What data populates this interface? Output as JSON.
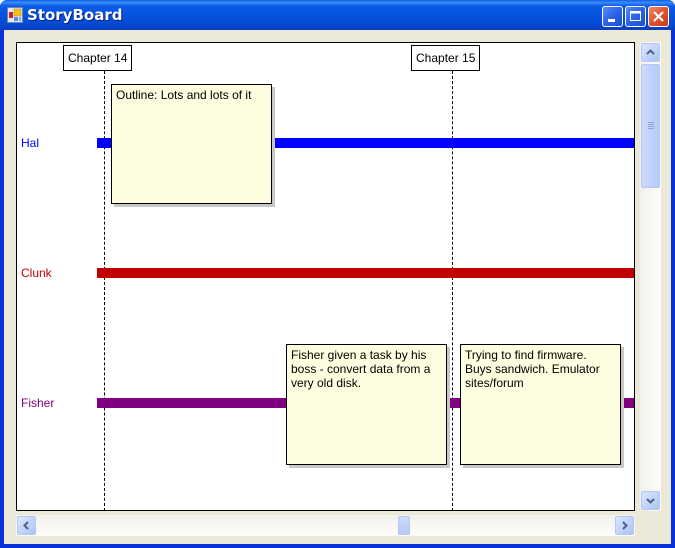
{
  "window": {
    "title": "StoryBoard",
    "icon": "storyboard-app-icon",
    "controls": [
      "minimize",
      "maximize",
      "close"
    ]
  },
  "chapters": [
    {
      "label": "Chapter 14"
    },
    {
      "label": "Chapter 15"
    }
  ],
  "characters": [
    {
      "name": "Hal",
      "color": "#0000ff"
    },
    {
      "name": "Clunk",
      "color": "#c00000"
    },
    {
      "name": "Fisher",
      "color": "#800080"
    }
  ],
  "notes": [
    {
      "character": "Hal",
      "text": "Outline: Lots and lots of it"
    },
    {
      "character": "Fisher",
      "text": "Fisher given a task by his boss - convert data from a very old disk."
    },
    {
      "character": "Fisher",
      "text": "Trying to find firmware. Buys sandwich. Emulator sites/forum"
    }
  ],
  "colors": {
    "note_background": "#fffde0",
    "window_frame": "#0831d9",
    "client_background": "#ece9d8"
  }
}
